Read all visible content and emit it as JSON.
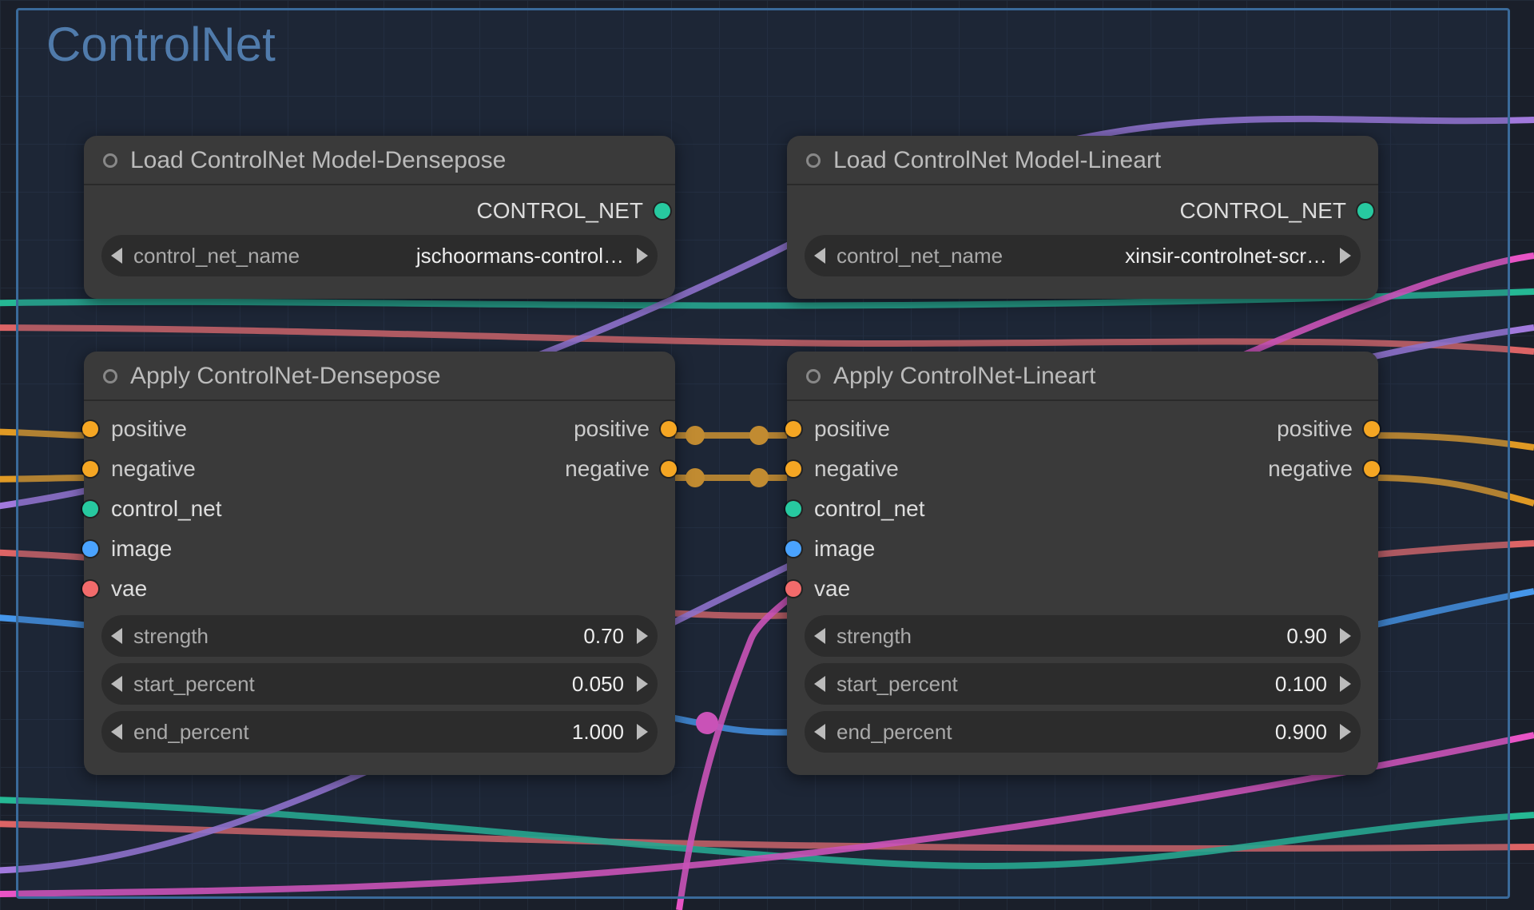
{
  "group": {
    "title": "ControlNet"
  },
  "nodes": {
    "load_densepose": {
      "title": "Load ControlNet Model-Densepose",
      "output_label": "CONTROL_NET",
      "widget_label": "control_net_name",
      "widget_value": "jschoormans-control…"
    },
    "load_lineart": {
      "title": "Load ControlNet Model-Lineart",
      "output_label": "CONTROL_NET",
      "widget_label": "control_net_name",
      "widget_value": "xinsir-controlnet-scr…"
    },
    "apply_densepose": {
      "title": "Apply ControlNet-Densepose",
      "inputs": {
        "positive": "positive",
        "negative": "negative",
        "control_net": "control_net",
        "image": "image",
        "vae": "vae"
      },
      "outputs": {
        "positive": "positive",
        "negative": "negative"
      },
      "widgets": {
        "strength_label": "strength",
        "strength_value": "0.70",
        "start_label": "start_percent",
        "start_value": "0.050",
        "end_label": "end_percent",
        "end_value": "1.000"
      }
    },
    "apply_lineart": {
      "title": "Apply ControlNet-Lineart",
      "inputs": {
        "positive": "positive",
        "negative": "negative",
        "control_net": "control_net",
        "image": "image",
        "vae": "vae"
      },
      "outputs": {
        "positive": "positive",
        "negative": "negative"
      },
      "widgets": {
        "strength_label": "strength",
        "strength_value": "0.90",
        "start_label": "start_percent",
        "start_value": "0.100",
        "end_label": "end_percent",
        "end_value": "0.900"
      }
    }
  }
}
